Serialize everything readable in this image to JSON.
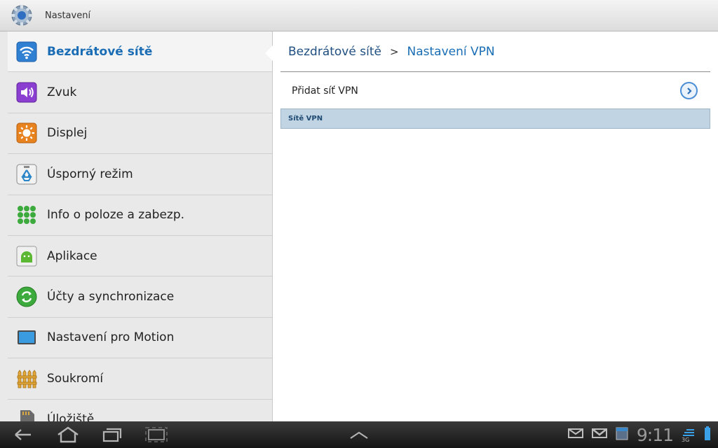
{
  "titlebar": {
    "title": "Nastavení",
    "icon": "gear-icon"
  },
  "sidebar": {
    "items": [
      {
        "label": "Bezdrátové sítě",
        "icon": "wifi-icon",
        "active": true
      },
      {
        "label": "Zvuk",
        "icon": "speaker-icon"
      },
      {
        "label": "Displej",
        "icon": "brightness-icon"
      },
      {
        "label": "Úsporný režim",
        "icon": "recycle-icon"
      },
      {
        "label": "Info o poloze a zabezp.",
        "icon": "location-grid-icon"
      },
      {
        "label": "Aplikace",
        "icon": "android-icon"
      },
      {
        "label": "Účty a synchronizace",
        "icon": "sync-icon"
      },
      {
        "label": "Nastavení pro Motion",
        "icon": "tablet-icon"
      },
      {
        "label": "Soukromí",
        "icon": "fence-icon"
      },
      {
        "label": "Úložiště",
        "icon": "sd-card-icon"
      }
    ]
  },
  "content": {
    "breadcrumb": {
      "parent": "Bezdrátové sítě",
      "separator": ">",
      "current": "Nastavení VPN"
    },
    "add_vpn_label": "Přidat síť VPN",
    "section_header": "Sítě VPN"
  },
  "sysbar": {
    "clock": "9:11",
    "network_label": "3G",
    "icons": [
      "back-icon",
      "home-icon",
      "recent-apps-icon",
      "screenshot-icon",
      "up-arrow-icon",
      "email-icon",
      "gmail-icon",
      "calendar-icon",
      "signal-icon",
      "battery-icon"
    ]
  },
  "colors": {
    "accent": "#1a6db5",
    "section_bg": "#c0d4e4"
  }
}
